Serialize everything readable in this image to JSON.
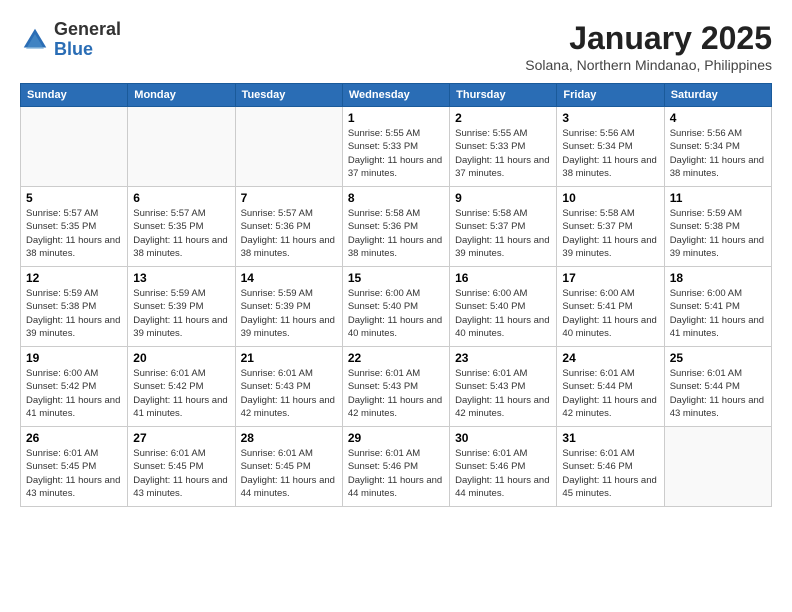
{
  "header": {
    "logo_general": "General",
    "logo_blue": "Blue",
    "month": "January 2025",
    "location": "Solana, Northern Mindanao, Philippines"
  },
  "weekdays": [
    "Sunday",
    "Monday",
    "Tuesday",
    "Wednesday",
    "Thursday",
    "Friday",
    "Saturday"
  ],
  "weeks": [
    [
      {
        "day": "",
        "info": ""
      },
      {
        "day": "",
        "info": ""
      },
      {
        "day": "",
        "info": ""
      },
      {
        "day": "1",
        "info": "Sunrise: 5:55 AM\nSunset: 5:33 PM\nDaylight: 11 hours\nand 37 minutes."
      },
      {
        "day": "2",
        "info": "Sunrise: 5:55 AM\nSunset: 5:33 PM\nDaylight: 11 hours\nand 37 minutes."
      },
      {
        "day": "3",
        "info": "Sunrise: 5:56 AM\nSunset: 5:34 PM\nDaylight: 11 hours\nand 38 minutes."
      },
      {
        "day": "4",
        "info": "Sunrise: 5:56 AM\nSunset: 5:34 PM\nDaylight: 11 hours\nand 38 minutes."
      }
    ],
    [
      {
        "day": "5",
        "info": "Sunrise: 5:57 AM\nSunset: 5:35 PM\nDaylight: 11 hours\nand 38 minutes."
      },
      {
        "day": "6",
        "info": "Sunrise: 5:57 AM\nSunset: 5:35 PM\nDaylight: 11 hours\nand 38 minutes."
      },
      {
        "day": "7",
        "info": "Sunrise: 5:57 AM\nSunset: 5:36 PM\nDaylight: 11 hours\nand 38 minutes."
      },
      {
        "day": "8",
        "info": "Sunrise: 5:58 AM\nSunset: 5:36 PM\nDaylight: 11 hours\nand 38 minutes."
      },
      {
        "day": "9",
        "info": "Sunrise: 5:58 AM\nSunset: 5:37 PM\nDaylight: 11 hours\nand 39 minutes."
      },
      {
        "day": "10",
        "info": "Sunrise: 5:58 AM\nSunset: 5:37 PM\nDaylight: 11 hours\nand 39 minutes."
      },
      {
        "day": "11",
        "info": "Sunrise: 5:59 AM\nSunset: 5:38 PM\nDaylight: 11 hours\nand 39 minutes."
      }
    ],
    [
      {
        "day": "12",
        "info": "Sunrise: 5:59 AM\nSunset: 5:38 PM\nDaylight: 11 hours\nand 39 minutes."
      },
      {
        "day": "13",
        "info": "Sunrise: 5:59 AM\nSunset: 5:39 PM\nDaylight: 11 hours\nand 39 minutes."
      },
      {
        "day": "14",
        "info": "Sunrise: 5:59 AM\nSunset: 5:39 PM\nDaylight: 11 hours\nand 39 minutes."
      },
      {
        "day": "15",
        "info": "Sunrise: 6:00 AM\nSunset: 5:40 PM\nDaylight: 11 hours\nand 40 minutes."
      },
      {
        "day": "16",
        "info": "Sunrise: 6:00 AM\nSunset: 5:40 PM\nDaylight: 11 hours\nand 40 minutes."
      },
      {
        "day": "17",
        "info": "Sunrise: 6:00 AM\nSunset: 5:41 PM\nDaylight: 11 hours\nand 40 minutes."
      },
      {
        "day": "18",
        "info": "Sunrise: 6:00 AM\nSunset: 5:41 PM\nDaylight: 11 hours\nand 41 minutes."
      }
    ],
    [
      {
        "day": "19",
        "info": "Sunrise: 6:00 AM\nSunset: 5:42 PM\nDaylight: 11 hours\nand 41 minutes."
      },
      {
        "day": "20",
        "info": "Sunrise: 6:01 AM\nSunset: 5:42 PM\nDaylight: 11 hours\nand 41 minutes."
      },
      {
        "day": "21",
        "info": "Sunrise: 6:01 AM\nSunset: 5:43 PM\nDaylight: 11 hours\nand 42 minutes."
      },
      {
        "day": "22",
        "info": "Sunrise: 6:01 AM\nSunset: 5:43 PM\nDaylight: 11 hours\nand 42 minutes."
      },
      {
        "day": "23",
        "info": "Sunrise: 6:01 AM\nSunset: 5:43 PM\nDaylight: 11 hours\nand 42 minutes."
      },
      {
        "day": "24",
        "info": "Sunrise: 6:01 AM\nSunset: 5:44 PM\nDaylight: 11 hours\nand 42 minutes."
      },
      {
        "day": "25",
        "info": "Sunrise: 6:01 AM\nSunset: 5:44 PM\nDaylight: 11 hours\nand 43 minutes."
      }
    ],
    [
      {
        "day": "26",
        "info": "Sunrise: 6:01 AM\nSunset: 5:45 PM\nDaylight: 11 hours\nand 43 minutes."
      },
      {
        "day": "27",
        "info": "Sunrise: 6:01 AM\nSunset: 5:45 PM\nDaylight: 11 hours\nand 43 minutes."
      },
      {
        "day": "28",
        "info": "Sunrise: 6:01 AM\nSunset: 5:45 PM\nDaylight: 11 hours\nand 44 minutes."
      },
      {
        "day": "29",
        "info": "Sunrise: 6:01 AM\nSunset: 5:46 PM\nDaylight: 11 hours\nand 44 minutes."
      },
      {
        "day": "30",
        "info": "Sunrise: 6:01 AM\nSunset: 5:46 PM\nDaylight: 11 hours\nand 44 minutes."
      },
      {
        "day": "31",
        "info": "Sunrise: 6:01 AM\nSunset: 5:46 PM\nDaylight: 11 hours\nand 45 minutes."
      },
      {
        "day": "",
        "info": ""
      }
    ]
  ]
}
